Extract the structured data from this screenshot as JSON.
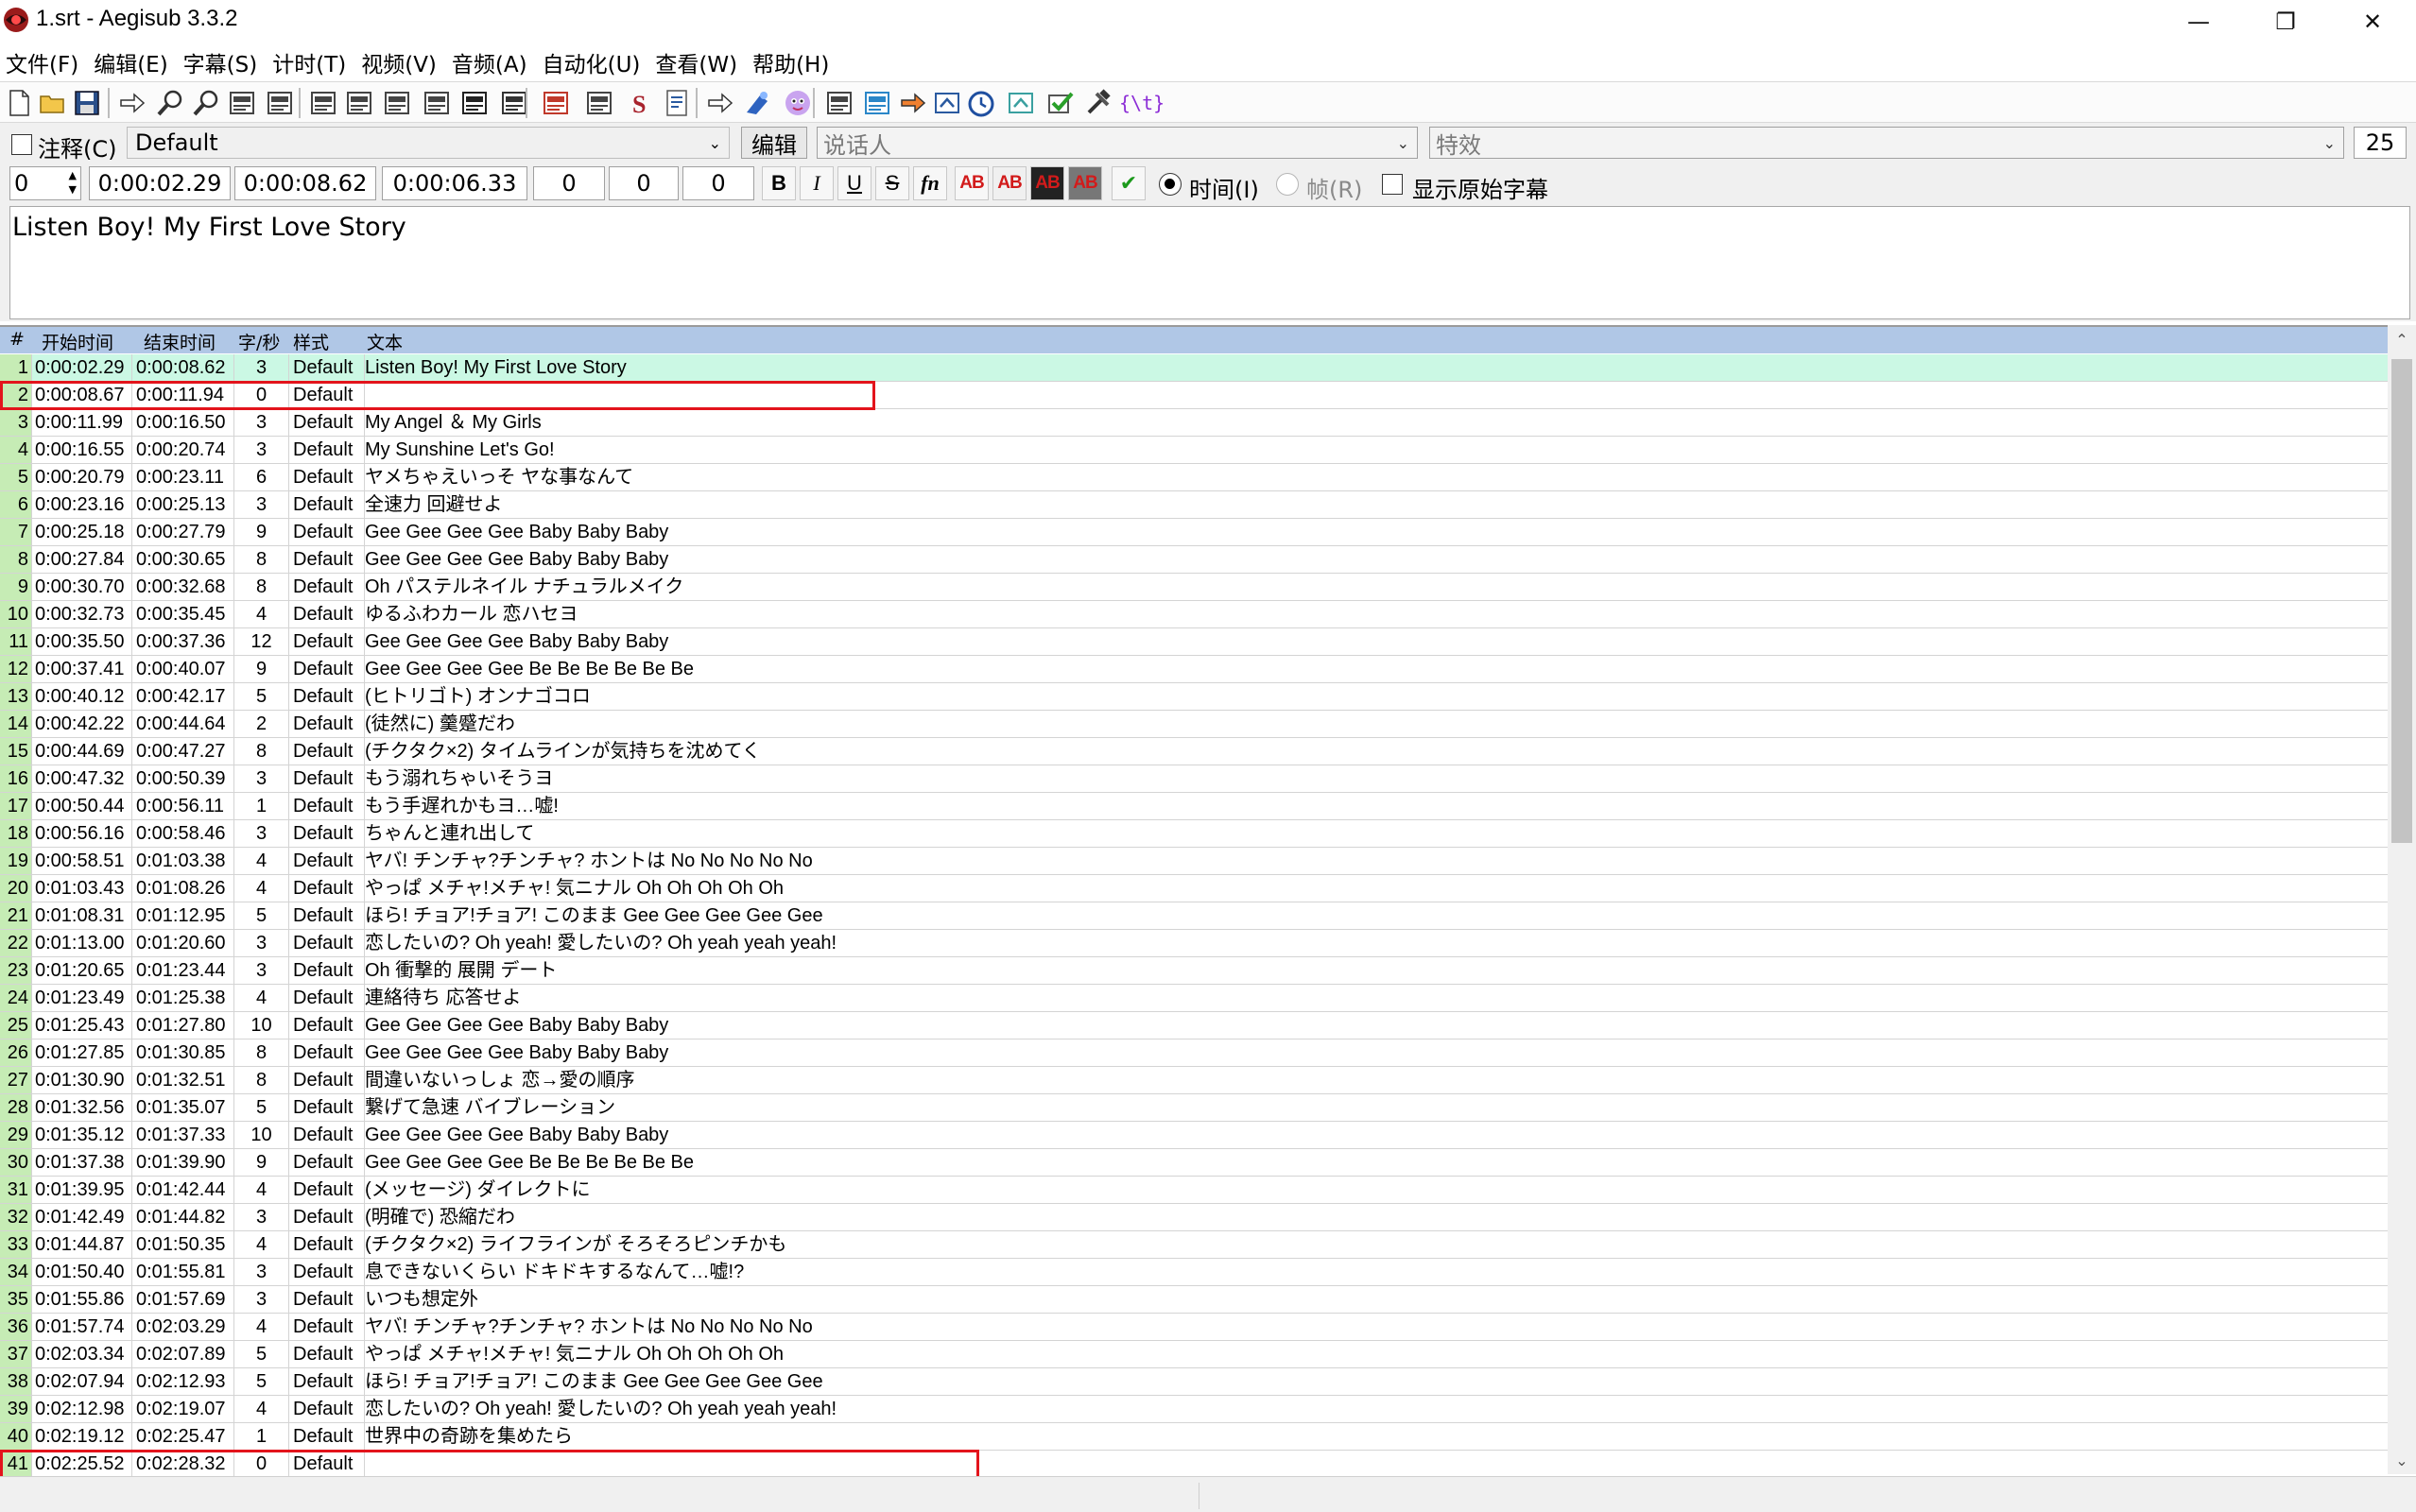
{
  "window": {
    "title": "1.srt - Aegisub 3.3.2",
    "minimize_glyph": "—",
    "restore_glyph": "❐",
    "close_glyph": "✕"
  },
  "menu": [
    "文件(F)",
    "编辑(E)",
    "字幕(S)",
    "计时(T)",
    "视频(V)",
    "音频(A)",
    "自动化(U)",
    "查看(W)",
    "帮助(H)"
  ],
  "toolbar": {
    "icons": [
      "new-file-icon",
      "open-file-icon",
      "save-icon",
      "jump-arrow-icon",
      "zoom-in-icon",
      "zoom-out-icon",
      "video-details-icon",
      "audio-details-icon",
      "styles-manager-icon",
      "attachments-icon",
      "fonts-collector-icon",
      "resample-icon",
      "shift-times-icon",
      "timing-post-processor-icon",
      "kanji-timer-icon",
      "translation-assistant-icon",
      "styling-assistant-icon",
      "spell-checker-icon",
      "paste-over-icon",
      "automation-icon",
      "mascot-icon",
      "select-lines-icon",
      "visual-typesetting-icon",
      "find-replace-icon",
      "export-icon",
      "clock-icon",
      "resolution-icon",
      "check-icon",
      "tools-icon",
      "override-tag-icon"
    ],
    "override_tag_glyph": "{\\t}"
  },
  "edit_box": {
    "comment_label": "注释(C)",
    "style_value": "Default",
    "edit_button": "编辑",
    "actor_placeholder": "说话人",
    "effect_placeholder": "特效",
    "line_count": "25",
    "layer": "0",
    "start_time": "0:00:02.29",
    "end_time": "0:00:08.62",
    "duration": "0:00:06.33",
    "margin_l": "0",
    "margin_r": "0",
    "margin_v": "0",
    "bold": "B",
    "italic": "I",
    "underline": "U",
    "strike": "S",
    "font": "fn",
    "ab_label": "AB",
    "time_mode_label": "时间(I)",
    "frame_mode_label": "帧(R)",
    "show_original_label": "显示原始字幕",
    "text": "Listen Boy! My First Love Story"
  },
  "grid": {
    "headers": {
      "num": "#",
      "start": "开始时间",
      "end": "结束时间",
      "cps": "字/秒",
      "style": "样式",
      "text": "文本"
    },
    "rows": [
      {
        "num": "1",
        "start": "0:00:02.29",
        "end": "0:00:08.62",
        "cps": "3",
        "style": "Default",
        "text": "Listen Boy! My First Love Story"
      },
      {
        "num": "2",
        "start": "0:00:08.67",
        "end": "0:00:11.94",
        "cps": "0",
        "style": "Default",
        "text": ""
      },
      {
        "num": "3",
        "start": "0:00:11.99",
        "end": "0:00:16.50",
        "cps": "3",
        "style": "Default",
        "text": "My Angel ＆ My Girls"
      },
      {
        "num": "4",
        "start": "0:00:16.55",
        "end": "0:00:20.74",
        "cps": "3",
        "style": "Default",
        "text": "My Sunshine Let's Go!"
      },
      {
        "num": "5",
        "start": "0:00:20.79",
        "end": "0:00:23.11",
        "cps": "6",
        "style": "Default",
        "text": "ヤメちゃえいっそ ヤな事なんて"
      },
      {
        "num": "6",
        "start": "0:00:23.16",
        "end": "0:00:25.13",
        "cps": "3",
        "style": "Default",
        "text": "全速力 回避せよ"
      },
      {
        "num": "7",
        "start": "0:00:25.18",
        "end": "0:00:27.79",
        "cps": "9",
        "style": "Default",
        "text": "Gee Gee Gee Gee Baby Baby Baby"
      },
      {
        "num": "8",
        "start": "0:00:27.84",
        "end": "0:00:30.65",
        "cps": "8",
        "style": "Default",
        "text": "Gee Gee Gee Gee Baby Baby Baby"
      },
      {
        "num": "9",
        "start": "0:00:30.70",
        "end": "0:00:32.68",
        "cps": "8",
        "style": "Default",
        "text": "Oh パステルネイル ナチュラルメイク"
      },
      {
        "num": "10",
        "start": "0:00:32.73",
        "end": "0:00:35.45",
        "cps": "4",
        "style": "Default",
        "text": "ゆるふわカール 恋ハセヨ"
      },
      {
        "num": "11",
        "start": "0:00:35.50",
        "end": "0:00:37.36",
        "cps": "12",
        "style": "Default",
        "text": "Gee Gee Gee Gee Baby Baby Baby"
      },
      {
        "num": "12",
        "start": "0:00:37.41",
        "end": "0:00:40.07",
        "cps": "9",
        "style": "Default",
        "text": "Gee Gee Gee Gee Be Be Be Be Be Be"
      },
      {
        "num": "13",
        "start": "0:00:40.12",
        "end": "0:00:42.17",
        "cps": "5",
        "style": "Default",
        "text": "(ヒトリゴト) オンナゴコロ"
      },
      {
        "num": "14",
        "start": "0:00:42.22",
        "end": "0:00:44.64",
        "cps": "2",
        "style": "Default",
        "text": "(徒然に) 羹蹙だわ"
      },
      {
        "num": "15",
        "start": "0:00:44.69",
        "end": "0:00:47.27",
        "cps": "8",
        "style": "Default",
        "text": "(チクタク×2) タイムラインが気持ちを沈めてく"
      },
      {
        "num": "16",
        "start": "0:00:47.32",
        "end": "0:00:50.39",
        "cps": "3",
        "style": "Default",
        "text": "もう溺れちゃいそうヨ"
      },
      {
        "num": "17",
        "start": "0:00:50.44",
        "end": "0:00:56.11",
        "cps": "1",
        "style": "Default",
        "text": "もう手遅れかもヨ…嘘!"
      },
      {
        "num": "18",
        "start": "0:00:56.16",
        "end": "0:00:58.46",
        "cps": "3",
        "style": "Default",
        "text": "ちゃんと連れ出して"
      },
      {
        "num": "19",
        "start": "0:00:58.51",
        "end": "0:01:03.38",
        "cps": "4",
        "style": "Default",
        "text": "ヤバ! チンチャ?チンチャ? ホントは No No No No No"
      },
      {
        "num": "20",
        "start": "0:01:03.43",
        "end": "0:01:08.26",
        "cps": "4",
        "style": "Default",
        "text": "やっぱ メチャ!メチャ! 気ニナル Oh Oh Oh Oh Oh"
      },
      {
        "num": "21",
        "start": "0:01:08.31",
        "end": "0:01:12.95",
        "cps": "5",
        "style": "Default",
        "text": "ほら! チョア!チョア! このまま Gee Gee Gee Gee Gee"
      },
      {
        "num": "22",
        "start": "0:01:13.00",
        "end": "0:01:20.60",
        "cps": "3",
        "style": "Default",
        "text": "恋したいの? Oh yeah! 愛したいの? Oh yeah yeah yeah!"
      },
      {
        "num": "23",
        "start": "0:01:20.65",
        "end": "0:01:23.44",
        "cps": "3",
        "style": "Default",
        "text": "Oh 衝撃的 展開 デート"
      },
      {
        "num": "24",
        "start": "0:01:23.49",
        "end": "0:01:25.38",
        "cps": "4",
        "style": "Default",
        "text": "連絡待ち 応答せよ"
      },
      {
        "num": "25",
        "start": "0:01:25.43",
        "end": "0:01:27.80",
        "cps": "10",
        "style": "Default",
        "text": "Gee Gee Gee Gee Baby Baby Baby"
      },
      {
        "num": "26",
        "start": "0:01:27.85",
        "end": "0:01:30.85",
        "cps": "8",
        "style": "Default",
        "text": "Gee Gee Gee Gee Baby Baby Baby"
      },
      {
        "num": "27",
        "start": "0:01:30.90",
        "end": "0:01:32.51",
        "cps": "8",
        "style": "Default",
        "text": "間違いないっしょ 恋→愛の順序"
      },
      {
        "num": "28",
        "start": "0:01:32.56",
        "end": "0:01:35.07",
        "cps": "5",
        "style": "Default",
        "text": "繋げて急速 バイブレーション"
      },
      {
        "num": "29",
        "start": "0:01:35.12",
        "end": "0:01:37.33",
        "cps": "10",
        "style": "Default",
        "text": "Gee Gee Gee Gee Baby Baby Baby"
      },
      {
        "num": "30",
        "start": "0:01:37.38",
        "end": "0:01:39.90",
        "cps": "9",
        "style": "Default",
        "text": "Gee Gee Gee Gee Be Be Be Be Be Be"
      },
      {
        "num": "31",
        "start": "0:01:39.95",
        "end": "0:01:42.44",
        "cps": "4",
        "style": "Default",
        "text": "(メッセージ) ダイレクトに"
      },
      {
        "num": "32",
        "start": "0:01:42.49",
        "end": "0:01:44.82",
        "cps": "3",
        "style": "Default",
        "text": "(明確で) 恐縮だわ"
      },
      {
        "num": "33",
        "start": "0:01:44.87",
        "end": "0:01:50.35",
        "cps": "4",
        "style": "Default",
        "text": "(チクタク×2) ライフラインが そろそろピンチかも"
      },
      {
        "num": "34",
        "start": "0:01:50.40",
        "end": "0:01:55.81",
        "cps": "3",
        "style": "Default",
        "text": "息できないくらい ドキドキするなんて…嘘!?"
      },
      {
        "num": "35",
        "start": "0:01:55.86",
        "end": "0:01:57.69",
        "cps": "3",
        "style": "Default",
        "text": "いつも想定外"
      },
      {
        "num": "36",
        "start": "0:01:57.74",
        "end": "0:02:03.29",
        "cps": "4",
        "style": "Default",
        "text": "ヤバ! チンチャ?チンチャ? ホントは No No No No No"
      },
      {
        "num": "37",
        "start": "0:02:03.34",
        "end": "0:02:07.89",
        "cps": "5",
        "style": "Default",
        "text": "やっぱ メチャ!メチャ! 気ニナル Oh Oh Oh Oh Oh"
      },
      {
        "num": "38",
        "start": "0:02:07.94",
        "end": "0:02:12.93",
        "cps": "5",
        "style": "Default",
        "text": "ほら! チョア!チョア! このまま Gee Gee Gee Gee Gee"
      },
      {
        "num": "39",
        "start": "0:02:12.98",
        "end": "0:02:19.07",
        "cps": "4",
        "style": "Default",
        "text": "恋したいの? Oh yeah! 愛したいの? Oh yeah yeah yeah!"
      },
      {
        "num": "40",
        "start": "0:02:19.12",
        "end": "0:02:25.47",
        "cps": "1",
        "style": "Default",
        "text": "世界中の奇跡を集めたら"
      },
      {
        "num": "41",
        "start": "0:02:25.52",
        "end": "0:02:28.32",
        "cps": "0",
        "style": "Default",
        "text": ""
      }
    ]
  },
  "scroll": {
    "up_glyph": "⌃",
    "down_glyph": "⌄"
  },
  "colors": {
    "header_bg": "#b0c7e6",
    "active_row_bg": "#cbf8e4",
    "row_number_bg": "#c6ecb5",
    "highlight_border": "#e3141c"
  }
}
